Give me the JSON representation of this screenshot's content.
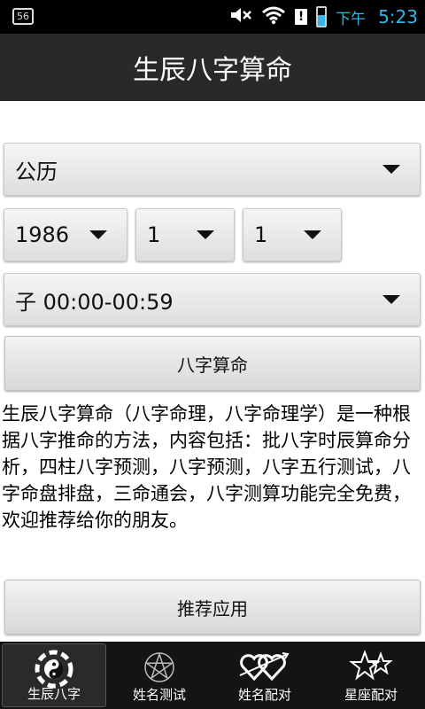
{
  "status_bar": {
    "notification_badge": "56",
    "ampm": "下午",
    "time": "5:23",
    "alert_mark": "!",
    "accent_color": "#33b5e5"
  },
  "app": {
    "title": "生辰八字算命"
  },
  "form": {
    "calendar_type": "公历",
    "year": "1986",
    "month": "1",
    "day": "1",
    "hour_period": "子 00:00-00:59",
    "calculate_button": "八字算命"
  },
  "description": "生辰八字算命（八字命理，八字命理学）是一种根据八字推命的方法，内容包括：批八字时辰算命分析，四柱八字预测，八字预测，八字五行测试，八字命盘排盘，三命通会，八字测算功能完全免费，欢迎推荐给你的朋友。",
  "recommend_button": "推荐应用",
  "tabs": [
    {
      "label": "生辰八字",
      "icon": "bagua-icon",
      "active": true
    },
    {
      "label": "姓名测试",
      "icon": "pentagram-icon",
      "active": false
    },
    {
      "label": "姓名配对",
      "icon": "hearts-arrow-icon",
      "active": false
    },
    {
      "label": "星座配对",
      "icon": "stars-icon",
      "active": false
    }
  ]
}
